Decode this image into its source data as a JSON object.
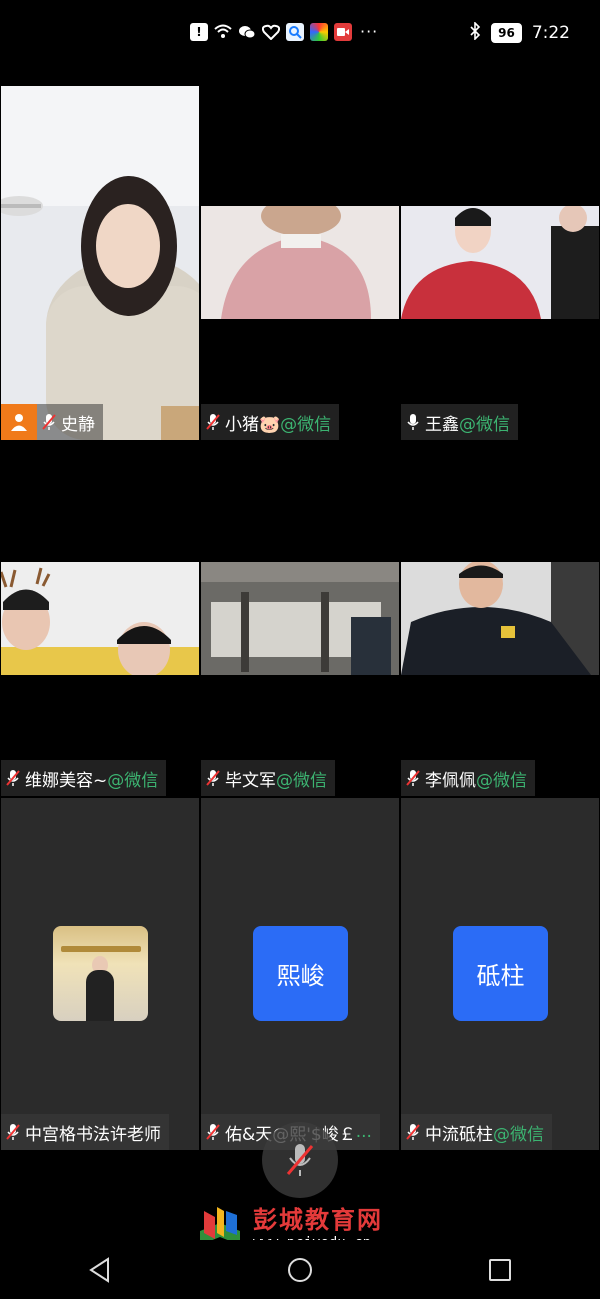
{
  "status_bar": {
    "icons": [
      "notification-alert-icon",
      "wifi-icon",
      "wechat-icon",
      "health-icon",
      "search-app-icon",
      "colorful-app-icon",
      "video-app-icon"
    ],
    "more": "···",
    "battery": "96",
    "time": "7:22"
  },
  "participants": [
    {
      "name": "史静",
      "suffix": "",
      "mic": "muted",
      "has_host_badge": true
    },
    {
      "name": "小猪🐷",
      "suffix": "@微信",
      "mic": "muted"
    },
    {
      "name": "王鑫",
      "suffix": "@微信",
      "mic": "on"
    },
    {
      "name": "维娜美容~",
      "suffix": "@微信",
      "mic": "muted"
    },
    {
      "name": "毕文军",
      "suffix": "@微信",
      "mic": "muted"
    },
    {
      "name": "李佩佩",
      "suffix": "@微信",
      "mic": "muted"
    },
    {
      "name": "中宫格书法许老师",
      "suffix": "",
      "mic": "muted",
      "avatar": "photo"
    },
    {
      "name": "佑&天@熙'$峻￡",
      "suffix": "...",
      "mic": "muted",
      "avatar_text": "熙峻"
    },
    {
      "name": "中流砥柱",
      "suffix": "@微信",
      "mic": "muted",
      "avatar_text": "砥柱"
    }
  ],
  "watermark": {
    "title": "彭城教育网",
    "url": "www.pcjyedu.cn"
  },
  "colors": {
    "avatar_blue": "#2b6cf6",
    "suffix_green": "#3cb371",
    "host_badge": "#f07a1a"
  }
}
